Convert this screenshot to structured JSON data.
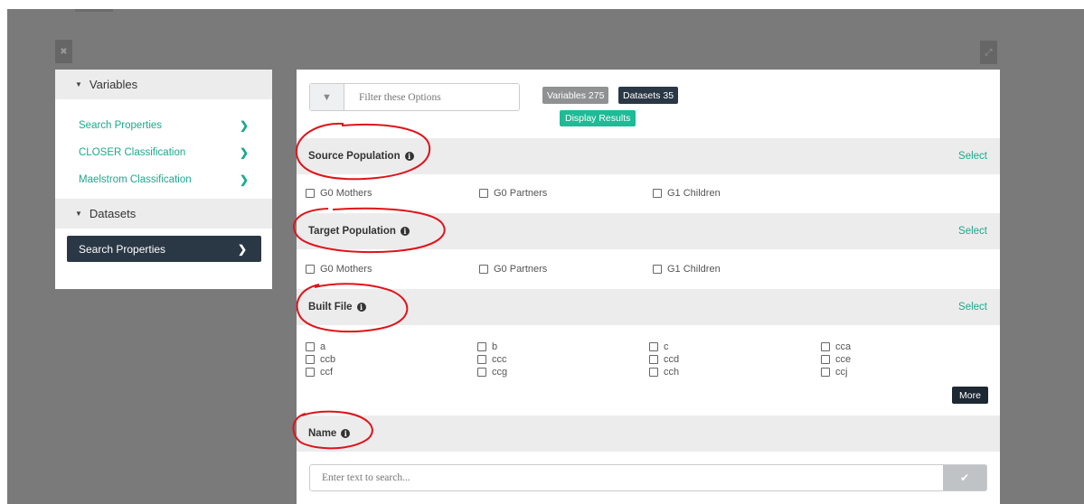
{
  "window": {
    "close_icon": "x-icon",
    "expand_icon": "expand-icon"
  },
  "sidebar": {
    "variables_header": "Variables",
    "variables_items": [
      {
        "label": "Search Properties"
      },
      {
        "label": "CLOSER Classification"
      },
      {
        "label": "Maelstrom Classification"
      }
    ],
    "datasets_header": "Datasets",
    "datasets_button": "Search Properties"
  },
  "toolbar": {
    "filter_placeholder": "Filter these Options",
    "variables_badge": "Variables 275",
    "datasets_badge": "Datasets 35",
    "display_results": "Display Results"
  },
  "sections": {
    "source_population": {
      "title": "Source Population",
      "select_label": "Select",
      "options": [
        "G0 Mothers",
        "G0 Partners",
        "G1 Children"
      ]
    },
    "target_population": {
      "title": "Target Population",
      "select_label": "Select",
      "options": [
        "G0 Mothers",
        "G0 Partners",
        "G1 Children"
      ]
    },
    "built_file": {
      "title": "Built File",
      "select_label": "Select",
      "options": [
        "a",
        "b",
        "c",
        "cca",
        "ccb",
        "ccc",
        "ccd",
        "cce",
        "ccf",
        "ccg",
        "cch",
        "ccj"
      ],
      "more_label": "More"
    },
    "name": {
      "title": "Name",
      "search_placeholder": "Enter text to search..."
    }
  },
  "colors": {
    "accent": "#1aaa8c",
    "dark": "#2a3846",
    "badge_grey": "#8f9293",
    "display_btn": "#1dbb96",
    "annotation": "#e0131a"
  }
}
